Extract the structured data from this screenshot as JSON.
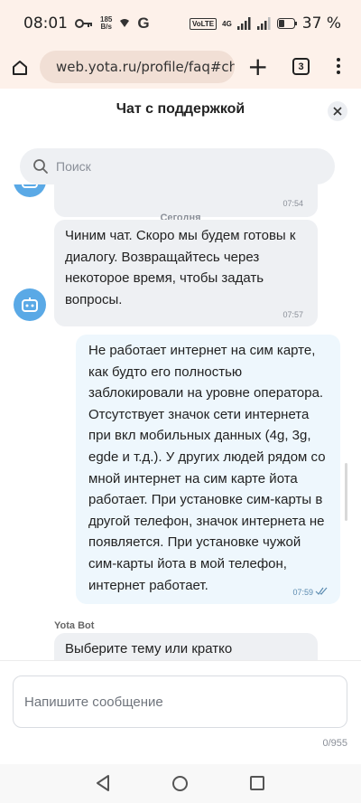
{
  "status_bar": {
    "time": "08:01",
    "net_speed_value": "185",
    "net_speed_unit": "B/s",
    "g_label": "G",
    "volte": "VoLTE",
    "network": "4G",
    "battery": "37 %"
  },
  "browser": {
    "url": "web.yota.ru/profile/faq#cha",
    "tab_count": "3"
  },
  "chat": {
    "title": "Чат с поддержкой",
    "search_placeholder": "Поиск",
    "date_separator": "Сегодня",
    "messages": [
      {
        "sender": "bot",
        "time": "07:54"
      },
      {
        "sender": "bot",
        "text": "Чиним чат. Скоро мы будем готовы к диалогу. Возвращайтесь через некоторое время, чтобы задать вопросы.",
        "time": "07:57"
      },
      {
        "sender": "user",
        "text": "Не работает интернет на сим карте, как будто его полностью заблокировали на уровне оператора. Отсутствует значок сети интернета при вкл мобильных данных (4g, 3g, egde и т.д.). У других людей рядом со мной интернет на сим карте йота работает. При установке сим-карты в другой телефон, значок интернета не появляется. При установке чужой сим-карты йота в мой телефон, интернет работает.",
        "time": "07:59"
      },
      {
        "sender": "bot",
        "name": "Yota Bot",
        "text": "Выберите тему или кратко"
      }
    ],
    "composer_placeholder": "Напишите сообщение",
    "char_counter": "0/955"
  },
  "colors": {
    "browser_bg": "#fdf1ea",
    "bot_bubble": "#eef0f3",
    "user_bubble": "#eef7fd",
    "avatar": "#5aa9e6"
  },
  "icons": [
    "home-icon",
    "site-settings-icon",
    "plus-icon",
    "tabs-icon",
    "overflow-menu-icon",
    "close-icon",
    "search-icon",
    "bot-avatar-icon",
    "read-receipt-icon",
    "back-nav-icon",
    "home-nav-icon",
    "recents-nav-icon"
  ]
}
